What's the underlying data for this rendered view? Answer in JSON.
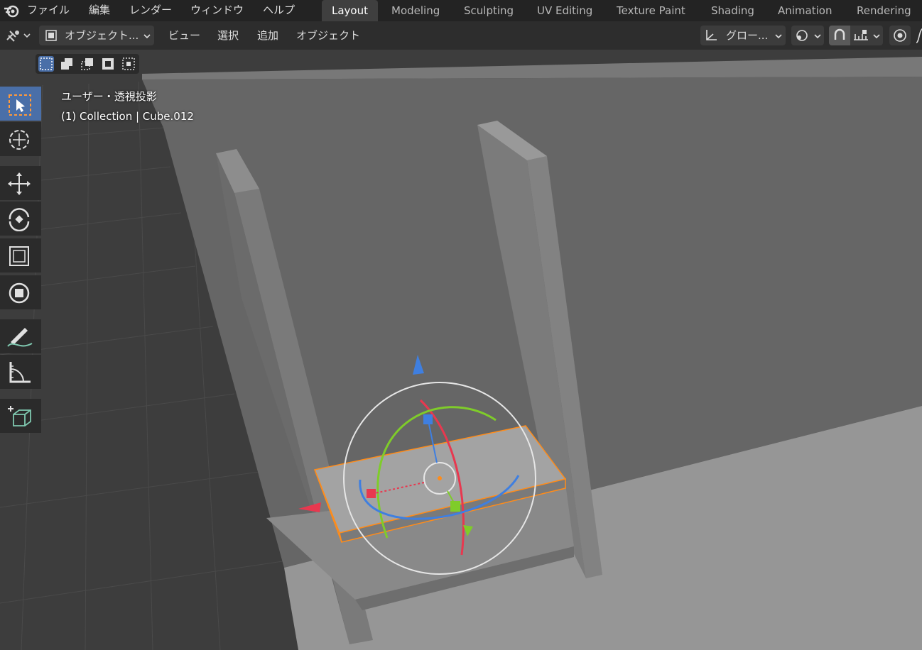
{
  "topbar": {
    "menus": [
      "ファイル",
      "編集",
      "レンダー",
      "ウィンドウ",
      "ヘルプ"
    ],
    "workspaces": [
      "Layout",
      "Modeling",
      "Sculpting",
      "UV Editing",
      "Texture Paint",
      "Shading",
      "Animation",
      "Rendering"
    ],
    "active_workspace": "Layout"
  },
  "header": {
    "mode_label": "オブジェクト...",
    "menus": [
      "ビュー",
      "選択",
      "追加",
      "オブジェクト"
    ],
    "transform_orientation": "グロー..."
  },
  "viewport": {
    "view_name": "ユーザー・透視投影",
    "collection_info": "(1) Collection | Cube.012"
  },
  "colors": {
    "accent": "#4a6fa8",
    "selection_outline": "#ff8c1a",
    "x_axis": "#e8384f",
    "y_axis": "#7fcc2a",
    "z_axis": "#3f7fe0"
  },
  "toolbar": {
    "tools": [
      "select-box",
      "cursor",
      "move",
      "rotate",
      "scale",
      "transform",
      "annotate",
      "measure",
      "add-cube"
    ],
    "active_tool": "select-box"
  }
}
